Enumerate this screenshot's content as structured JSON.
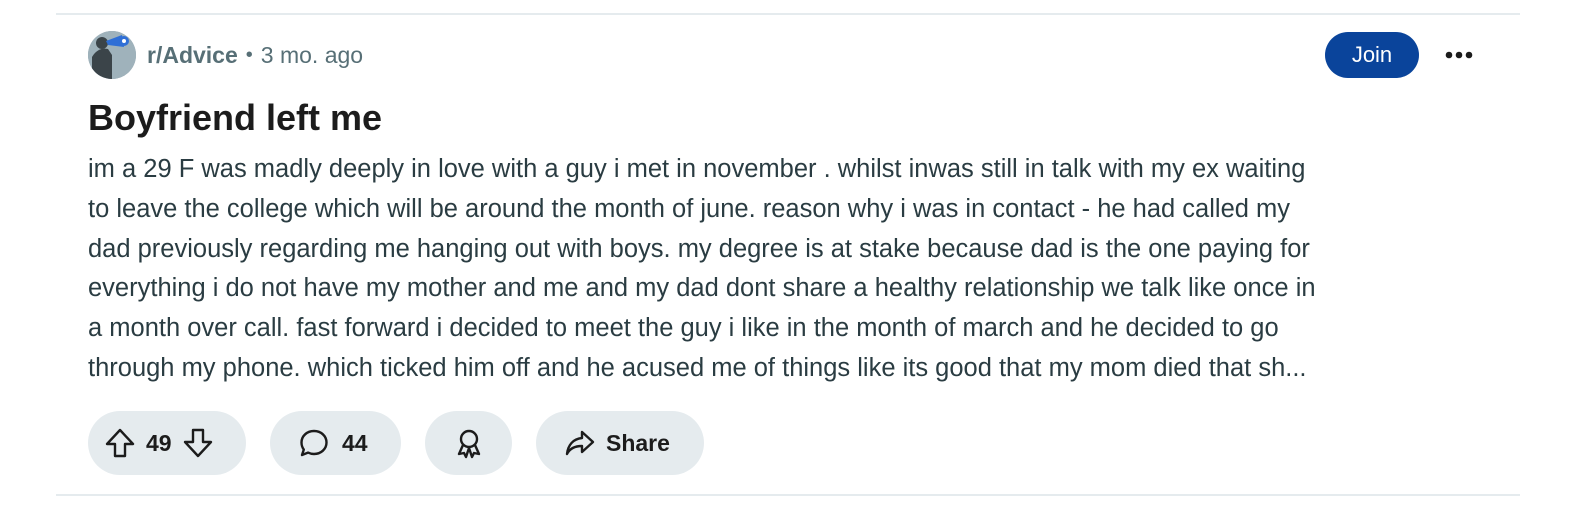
{
  "post": {
    "subreddit": "r/Advice",
    "separator": "•",
    "time_ago": "3 mo. ago",
    "join_label": "Join",
    "title": "Boyfriend left me",
    "body_lines": [
      "im a 29 F was madly deeply in love with a guy i met in november . whilst inwas still in talk with my ex waiting",
      "to leave the college which will be around the month of june. reason why i was in contact - he had called my",
      "dad previously regarding me hanging out with boys. my degree is at stake because dad is the one paying for",
      "everything i do not have my mother and me and my dad dont share a healthy relationship we talk like once in",
      "a month over call. fast forward i decided to meet the guy i like in the month of march and he decided to go",
      "through my phone. which ticked him off and he acused me of things like its good that my mom died that sh..."
    ]
  },
  "actions": {
    "vote_count": "49",
    "comment_count": "44",
    "share_label": "Share"
  },
  "icons": {
    "avatar": "subreddit-avatar",
    "more": "more-options-icon",
    "upvote": "upvote-arrow-icon",
    "downvote": "downvote-arrow-icon",
    "comment": "comment-bubble-icon",
    "award": "award-icon",
    "share": "share-arrow-icon"
  },
  "colors": {
    "join_button": "#0a449b",
    "pill_background": "#e5ebee",
    "meta_text": "#576f76"
  }
}
